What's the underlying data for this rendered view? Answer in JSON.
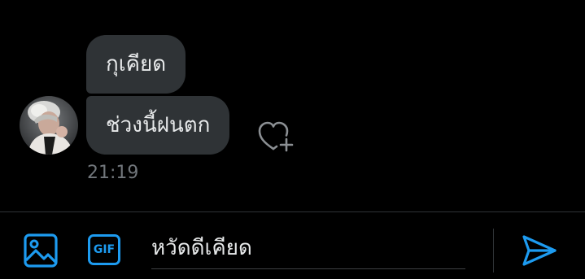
{
  "conversation": {
    "messages": [
      {
        "text": "กุเคียด"
      },
      {
        "text": "ช่วงนี้ฝนตก"
      }
    ],
    "timestamp": "21:19",
    "reaction_icon": "heart-plus-icon"
  },
  "composer": {
    "media_icon": "image-icon",
    "gif_label": "GIF",
    "input_value": "หวัดดีเคียด",
    "send_icon": "send-icon"
  },
  "colors": {
    "background": "#000000",
    "bubble": "#2f3336",
    "text": "#e7e9ea",
    "muted": "#71767b",
    "accent": "#1d9bf0"
  }
}
